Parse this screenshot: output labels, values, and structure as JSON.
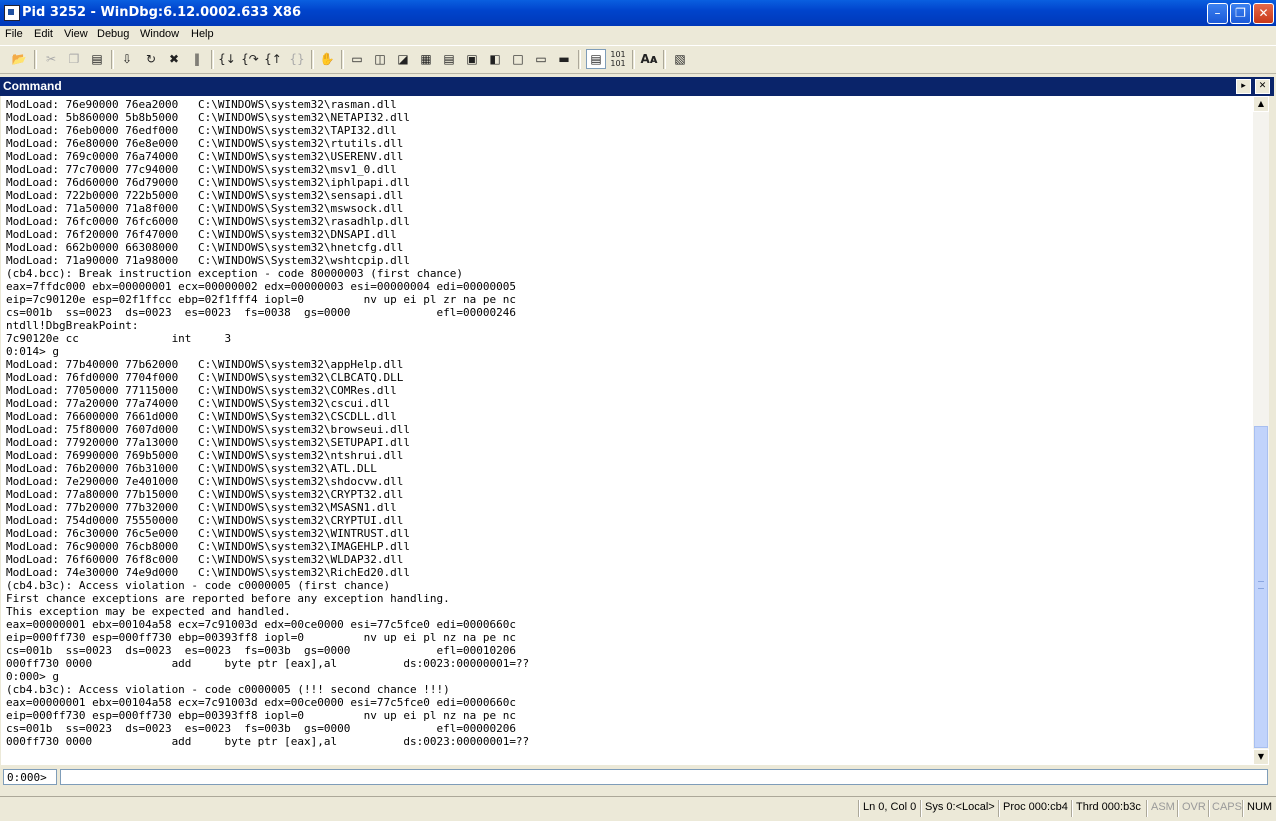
{
  "window": {
    "title": "Pid 3252 - WinDbg:6.12.0002.633 X86",
    "minimize_glyph": "–",
    "maximize_glyph": "❐",
    "close_glyph": "✕"
  },
  "menu": [
    "File",
    "Edit",
    "View",
    "Debug",
    "Window",
    "Help"
  ],
  "toolbar_icons": [
    "open-icon",
    "cut-icon",
    "copy-icon",
    "paste-icon",
    "go-icon",
    "restart-icon",
    "stop-debugging-icon",
    "break-icon",
    "step-into-icon",
    "step-over-icon",
    "step-out-icon",
    "run-to-cursor-icon",
    "source-mode-icon",
    "command-icon",
    "watch-icon",
    "locals-icon",
    "registers-icon",
    "memory-icon",
    "call-stack-icon",
    "disassembly-icon",
    "scratch-pad-icon",
    "source-mode-toggle-icon",
    "hex-mode-icon",
    "font-icon",
    "options-icon"
  ],
  "command_window": {
    "title": "Command",
    "lines": [
      "ModLoad: 76e90000 76ea2000   C:\\WINDOWS\\system32\\rasman.dll",
      "ModLoad: 5b860000 5b8b5000   C:\\WINDOWS\\system32\\NETAPI32.dll",
      "ModLoad: 76eb0000 76edf000   C:\\WINDOWS\\system32\\TAPI32.dll",
      "ModLoad: 76e80000 76e8e000   C:\\WINDOWS\\system32\\rtutils.dll",
      "ModLoad: 769c0000 76a74000   C:\\WINDOWS\\system32\\USERENV.dll",
      "ModLoad: 77c70000 77c94000   C:\\WINDOWS\\system32\\msv1_0.dll",
      "ModLoad: 76d60000 76d79000   C:\\WINDOWS\\system32\\iphlpapi.dll",
      "ModLoad: 722b0000 722b5000   C:\\WINDOWS\\system32\\sensapi.dll",
      "ModLoad: 71a50000 71a8f000   C:\\WINDOWS\\System32\\mswsock.dll",
      "ModLoad: 76fc0000 76fc6000   C:\\WINDOWS\\system32\\rasadhlp.dll",
      "ModLoad: 76f20000 76f47000   C:\\WINDOWS\\system32\\DNSAPI.dll",
      "ModLoad: 662b0000 66308000   C:\\WINDOWS\\system32\\hnetcfg.dll",
      "ModLoad: 71a90000 71a98000   C:\\WINDOWS\\System32\\wshtcpip.dll",
      "(cb4.bcc): Break instruction exception - code 80000003 (first chance)",
      "eax=7ffdc000 ebx=00000001 ecx=00000002 edx=00000003 esi=00000004 edi=00000005",
      "eip=7c90120e esp=02f1ffcc ebp=02f1fff4 iopl=0         nv up ei pl zr na pe nc",
      "cs=001b  ss=0023  ds=0023  es=0023  fs=0038  gs=0000             efl=00000246",
      "ntdll!DbgBreakPoint:",
      "7c90120e cc              int     3",
      "0:014> g",
      "ModLoad: 77b40000 77b62000   C:\\WINDOWS\\system32\\appHelp.dll",
      "ModLoad: 76fd0000 7704f000   C:\\WINDOWS\\system32\\CLBCATQ.DLL",
      "ModLoad: 77050000 77115000   C:\\WINDOWS\\system32\\COMRes.dll",
      "ModLoad: 77a20000 77a74000   C:\\WINDOWS\\System32\\cscui.dll",
      "ModLoad: 76600000 7661d000   C:\\WINDOWS\\System32\\CSCDLL.dll",
      "ModLoad: 75f80000 7607d000   C:\\WINDOWS\\system32\\browseui.dll",
      "ModLoad: 77920000 77a13000   C:\\WINDOWS\\system32\\SETUPAPI.dll",
      "ModLoad: 76990000 769b5000   C:\\WINDOWS\\system32\\ntshrui.dll",
      "ModLoad: 76b20000 76b31000   C:\\WINDOWS\\system32\\ATL.DLL",
      "ModLoad: 7e290000 7e401000   C:\\WINDOWS\\system32\\shdocvw.dll",
      "ModLoad: 77a80000 77b15000   C:\\WINDOWS\\system32\\CRYPT32.dll",
      "ModLoad: 77b20000 77b32000   C:\\WINDOWS\\system32\\MSASN1.dll",
      "ModLoad: 754d0000 75550000   C:\\WINDOWS\\system32\\CRYPTUI.dll",
      "ModLoad: 76c30000 76c5e000   C:\\WINDOWS\\system32\\WINTRUST.dll",
      "ModLoad: 76c90000 76cb8000   C:\\WINDOWS\\system32\\IMAGEHLP.dll",
      "ModLoad: 76f60000 76f8c000   C:\\WINDOWS\\system32\\WLDAP32.dll",
      "ModLoad: 74e30000 74e9d000   C:\\WINDOWS\\system32\\RichEd20.dll",
      "(cb4.b3c): Access violation - code c0000005 (first chance)",
      "First chance exceptions are reported before any exception handling.",
      "This exception may be expected and handled.",
      "eax=00000001 ebx=00104a58 ecx=7c91003d edx=00ce0000 esi=77c5fce0 edi=0000660c",
      "eip=000ff730 esp=000ff730 ebp=00393ff8 iopl=0         nv up ei pl nz na pe nc",
      "cs=001b  ss=0023  ds=0023  es=0023  fs=003b  gs=0000             efl=00010206",
      "000ff730 0000            add     byte ptr [eax],al          ds:0023:00000001=??",
      "0:000> g",
      "(cb4.b3c): Access violation - code c0000005 (!!! second chance !!!)",
      "eax=00000001 ebx=00104a58 ecx=7c91003d edx=00ce0000 esi=77c5fce0 edi=0000660c",
      "eip=000ff730 esp=000ff730 ebp=00393ff8 iopl=0         nv up ei pl nz na pe nc",
      "cs=001b  ss=0023  ds=0023  es=0023  fs=003b  gs=0000             efl=00000206",
      "000ff730 0000            add     byte ptr [eax],al          ds:0023:00000001=??"
    ],
    "prompt": "0:000>",
    "input_value": ""
  },
  "status_bar": {
    "position": "Ln 0, Col 0",
    "system": "Sys 0:<Local>",
    "process": "Proc 000:cb4",
    "thread": "Thrd 000:b3c",
    "asm": "ASM",
    "ovr": "OVR",
    "caps": "CAPS",
    "num": "NUM"
  },
  "colors": {
    "title_bar": "#0044cc",
    "command_bar": "#0a246a",
    "window_bg": "#ece9d8",
    "scroll_thumb": "#c1d3fb"
  }
}
